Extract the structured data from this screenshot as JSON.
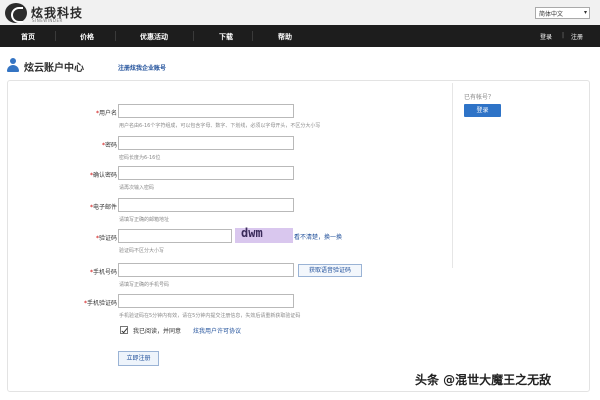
{
  "header": {
    "logo_name": "炫我科技",
    "logo_sub": "SINEWINDER",
    "language": "简体中文"
  },
  "nav": {
    "items": [
      "首页",
      "价格",
      "优惠活动",
      "下载",
      "帮助"
    ],
    "login": "登录",
    "sep": "|",
    "register": "注册"
  },
  "account": {
    "title": "炫云账户中心",
    "enterprise_link": "注册炫我企业账号"
  },
  "form": {
    "username": {
      "label": "用户名",
      "hint": "用户名由6-16个字符组成，可以包含字母、数字、下划线，必须以字母开头，不区分大小写"
    },
    "password": {
      "label": "密码",
      "hint": "密码长度为6-16位"
    },
    "confirm": {
      "label": "确认密码",
      "hint": "请再次输入密码"
    },
    "email": {
      "label": "电子邮件",
      "hint": "请填写正确的邮箱地址"
    },
    "captcha": {
      "label": "验证码",
      "hint": "验证码不区分大小写",
      "image_text": "dwm",
      "refresh": "看不清楚，换一换"
    },
    "phone": {
      "label": "手机号码",
      "hint": "请填写正确的手机号码",
      "sms_button": "获取语音验证码"
    },
    "sms_code": {
      "label": "手机验证码",
      "hint": "手机验证码在5分钟内有效，请在5分钟内提交注册信息，失效后请重新获取验证码"
    },
    "agree_text": "我已阅读，并同意",
    "agree_link": "炫我用户许可协议",
    "submit": "立即注册"
  },
  "side": {
    "question": "已有帐号？",
    "login_button": "登录"
  },
  "watermark": "头条 @混世大魔王之无敌",
  "colors": {
    "nav_bg": "#1d1d1d",
    "accent_blue": "#2e73c7",
    "link_blue": "#1f4f9a",
    "required_red": "#cc0000"
  }
}
